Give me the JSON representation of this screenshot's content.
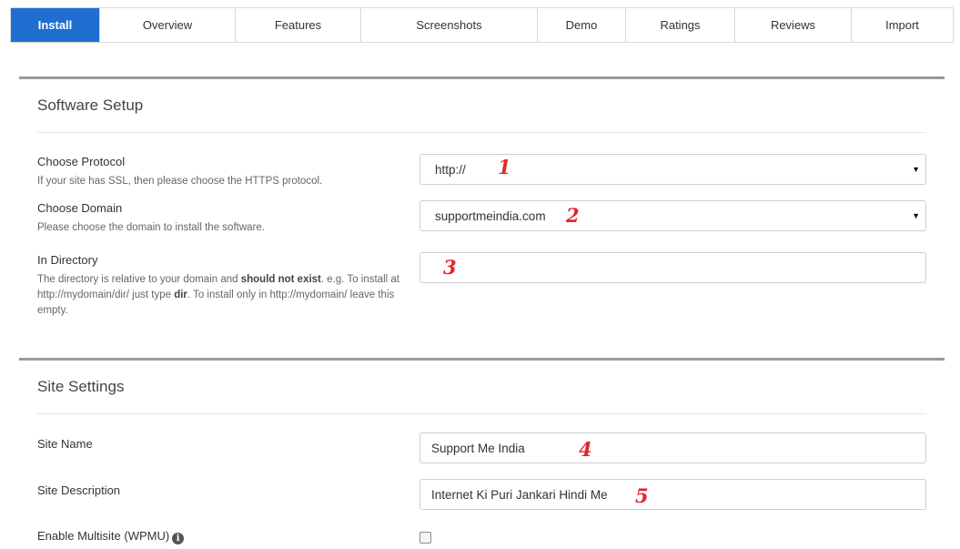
{
  "tabs": [
    {
      "label": "Install",
      "active": true
    },
    {
      "label": "Overview"
    },
    {
      "label": "Features"
    },
    {
      "label": "Screenshots"
    },
    {
      "label": "Demo"
    },
    {
      "label": "Ratings"
    },
    {
      "label": "Reviews"
    },
    {
      "label": "Import"
    }
  ],
  "software_setup": {
    "title": "Software Setup",
    "protocol": {
      "label": "Choose Protocol",
      "help": "If your site has SSL, then please choose the HTTPS protocol.",
      "value": "http://",
      "marker": "1"
    },
    "domain": {
      "label": "Choose Domain",
      "help": "Please choose the domain to install the software.",
      "value": "supportmeindia.com",
      "marker": "2"
    },
    "directory": {
      "label": "In Directory",
      "help_part1": "The directory is relative to your domain and ",
      "help_bold1": "should not exist",
      "help_part2": ". e.g. To install at http://mydomain/dir/ just type ",
      "help_bold2": "dir",
      "help_part3": ". To install only in http://mydomain/ leave this empty.",
      "value": "",
      "marker": "3"
    }
  },
  "site_settings": {
    "title": "Site Settings",
    "site_name": {
      "label": "Site Name",
      "value": "Support Me India",
      "marker": "4"
    },
    "site_description": {
      "label": "Site Description",
      "value": "Internet Ki Puri Jankari Hindi Me",
      "marker": "5"
    },
    "multisite": {
      "label": "Enable Multisite (WPMU)",
      "info_icon": "info-icon",
      "checked": false
    }
  },
  "colors": {
    "accent": "#1f6fd0",
    "marker": "#e0262b"
  }
}
